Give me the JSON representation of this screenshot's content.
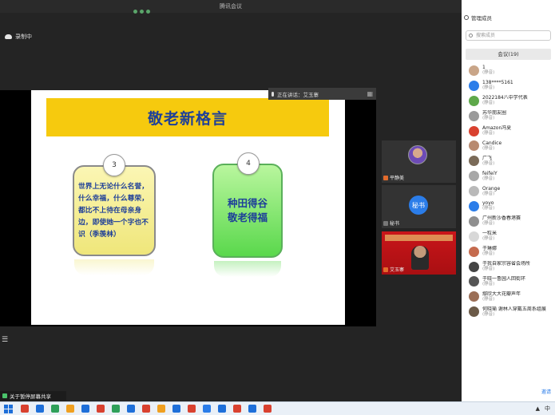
{
  "window": {
    "title": "腾讯会议"
  },
  "recording": {
    "label": "录制中"
  },
  "speaking": {
    "label": "正在讲话：艾玉寨",
    "icon": "grid-view-icon"
  },
  "slide": {
    "title": "敬老新格言",
    "card_left": {
      "number": "3",
      "text": "世界上无论什么名誉，什么幸福，什么尊荣，都比不上待在母亲身边，即使她一个字也不识（季羡林）"
    },
    "card_right": {
      "number": "4",
      "text_line1": "种田得谷",
      "text_line2": "敬老得福"
    }
  },
  "videos": [
    {
      "name": "平静美",
      "type": "avatar"
    },
    {
      "name": "秘书",
      "avatar_text": "秘书",
      "type": "secret"
    },
    {
      "name": "艾玉寨",
      "type": "camera"
    }
  ],
  "share": {
    "label": "关于暂停屏幕共享"
  },
  "panel": {
    "header": "管理成员",
    "search_placeholder": "搜索成员",
    "tab": "会议(19)",
    "footer": "邀请",
    "members": [
      {
        "name": "1",
        "sub": "(静音)",
        "color": "#c9a588"
      },
      {
        "name": "138****5161",
        "sub": "(静音)",
        "color": "#2b7de9"
      },
      {
        "name": "2022184八中学代表",
        "sub": "(静音)",
        "color": "#5ea84a"
      },
      {
        "name": "苏华朋友圈",
        "sub": "(静音)",
        "color": "#9a9a9a"
      },
      {
        "name": "Amazon冯夏",
        "sub": "(静音)",
        "color": "#d9412f"
      },
      {
        "name": "Candice",
        "sub": "(静音)",
        "color": "#b88a70"
      },
      {
        "name": "广飞",
        "sub": "(静音)",
        "color": "#7a6a58"
      },
      {
        "name": "feifeiY",
        "sub": "(静音)",
        "color": "#a7a7a7"
      },
      {
        "name": "Orange",
        "sub": "(静音)",
        "color": "#b9b9b9"
      },
      {
        "name": "yoyo",
        "sub": "(静音)",
        "color": "#2b7de9"
      },
      {
        "name": "广州新沙香春港赛",
        "sub": "(静音)",
        "color": "#8f8f8f"
      },
      {
        "name": "一粒米",
        "sub": "(静音)",
        "color": "#d8d8d8"
      },
      {
        "name": "于琳娜",
        "sub": "(静音)",
        "color": "#c56b4e"
      },
      {
        "name": "于我自家宗容省会场所",
        "sub": "(静音)",
        "color": "#444"
      },
      {
        "name": "于晓一鲁园人回街环",
        "sub": "(静音)",
        "color": "#555"
      },
      {
        "name": "鄢欣大大花瓣声年",
        "sub": "(静音)",
        "color": "#9b6e56"
      },
      {
        "name": "何晓瑜 谢林人穿戴五周系组展",
        "sub": "(静音)",
        "color": "#6b5a48"
      }
    ]
  },
  "taskbar": {
    "icons": [
      "#d9412f",
      "#1e6fd9",
      "#2ea05a",
      "#f0a020",
      "#1e6fd9",
      "#d9412f",
      "#2ea05a",
      "#1e6fd9",
      "#d9412f",
      "#f0a020",
      "#1e6fd9",
      "#d9412f",
      "#2b7de9",
      "#1e6fd9",
      "#d9412f",
      "#1e6fd9",
      "#d9412f"
    ],
    "tray": "中"
  }
}
